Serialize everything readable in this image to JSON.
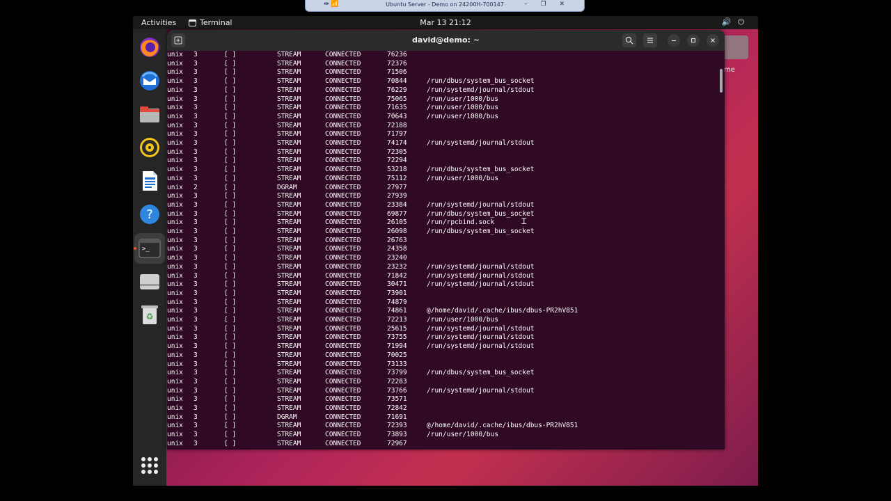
{
  "remote_bar": {
    "title": "Ubuntu Server - Demo on 24200H-700147",
    "left_icons": "⇹ 📶",
    "right_icons": "– ❐ ✕"
  },
  "topbar": {
    "activities": "Activities",
    "app_name": "Terminal",
    "clock": "Mar 13  21:12"
  },
  "desktop": {
    "home_label": "me"
  },
  "dock": {
    "items": [
      "Firefox",
      "Thunderbird",
      "Files",
      "Rhythmbox",
      "LibreOffice Writer",
      "Help",
      "Terminal",
      "Removable Drive",
      "Trash"
    ],
    "apps_button": "Show Applications"
  },
  "terminal": {
    "title": "david@demo: ~",
    "rows": [
      {
        "proto": "unix",
        "ref": "3",
        "flags": "[ ]",
        "type": "STREAM",
        "state": "CONNECTED",
        "inode": "76236",
        "path": ""
      },
      {
        "proto": "unix",
        "ref": "3",
        "flags": "[ ]",
        "type": "STREAM",
        "state": "CONNECTED",
        "inode": "72376",
        "path": ""
      },
      {
        "proto": "unix",
        "ref": "3",
        "flags": "[ ]",
        "type": "STREAM",
        "state": "CONNECTED",
        "inode": "71506",
        "path": ""
      },
      {
        "proto": "unix",
        "ref": "3",
        "flags": "[ ]",
        "type": "STREAM",
        "state": "CONNECTED",
        "inode": "70844",
        "path": "/run/dbus/system_bus_socket"
      },
      {
        "proto": "unix",
        "ref": "3",
        "flags": "[ ]",
        "type": "STREAM",
        "state": "CONNECTED",
        "inode": "76229",
        "path": "/run/systemd/journal/stdout"
      },
      {
        "proto": "unix",
        "ref": "3",
        "flags": "[ ]",
        "type": "STREAM",
        "state": "CONNECTED",
        "inode": "75065",
        "path": "/run/user/1000/bus"
      },
      {
        "proto": "unix",
        "ref": "3",
        "flags": "[ ]",
        "type": "STREAM",
        "state": "CONNECTED",
        "inode": "71635",
        "path": "/run/user/1000/bus"
      },
      {
        "proto": "unix",
        "ref": "3",
        "flags": "[ ]",
        "type": "STREAM",
        "state": "CONNECTED",
        "inode": "70643",
        "path": "/run/user/1000/bus"
      },
      {
        "proto": "unix",
        "ref": "3",
        "flags": "[ ]",
        "type": "STREAM",
        "state": "CONNECTED",
        "inode": "72188",
        "path": ""
      },
      {
        "proto": "unix",
        "ref": "3",
        "flags": "[ ]",
        "type": "STREAM",
        "state": "CONNECTED",
        "inode": "71797",
        "path": ""
      },
      {
        "proto": "unix",
        "ref": "3",
        "flags": "[ ]",
        "type": "STREAM",
        "state": "CONNECTED",
        "inode": "74174",
        "path": "/run/systemd/journal/stdout"
      },
      {
        "proto": "unix",
        "ref": "3",
        "flags": "[ ]",
        "type": "STREAM",
        "state": "CONNECTED",
        "inode": "72305",
        "path": ""
      },
      {
        "proto": "unix",
        "ref": "3",
        "flags": "[ ]",
        "type": "STREAM",
        "state": "CONNECTED",
        "inode": "72294",
        "path": ""
      },
      {
        "proto": "unix",
        "ref": "3",
        "flags": "[ ]",
        "type": "STREAM",
        "state": "CONNECTED",
        "inode": "53218",
        "path": "/run/dbus/system_bus_socket"
      },
      {
        "proto": "unix",
        "ref": "3",
        "flags": "[ ]",
        "type": "STREAM",
        "state": "CONNECTED",
        "inode": "75112",
        "path": "/run/user/1000/bus"
      },
      {
        "proto": "unix",
        "ref": "2",
        "flags": "[ ]",
        "type": "DGRAM",
        "state": "CONNECTED",
        "inode": "27977",
        "path": ""
      },
      {
        "proto": "unix",
        "ref": "3",
        "flags": "[ ]",
        "type": "STREAM",
        "state": "CONNECTED",
        "inode": "27939",
        "path": ""
      },
      {
        "proto": "unix",
        "ref": "3",
        "flags": "[ ]",
        "type": "STREAM",
        "state": "CONNECTED",
        "inode": "23384",
        "path": "/run/systemd/journal/stdout"
      },
      {
        "proto": "unix",
        "ref": "3",
        "flags": "[ ]",
        "type": "STREAM",
        "state": "CONNECTED",
        "inode": "69877",
        "path": "/run/dbus/system_bus_socket"
      },
      {
        "proto": "unix",
        "ref": "3",
        "flags": "[ ]",
        "type": "STREAM",
        "state": "CONNECTED",
        "inode": "26105",
        "path": "/run/rpcbind.sock"
      },
      {
        "proto": "unix",
        "ref": "3",
        "flags": "[ ]",
        "type": "STREAM",
        "state": "CONNECTED",
        "inode": "26098",
        "path": "/run/dbus/system_bus_socket"
      },
      {
        "proto": "unix",
        "ref": "3",
        "flags": "[ ]",
        "type": "STREAM",
        "state": "CONNECTED",
        "inode": "26763",
        "path": ""
      },
      {
        "proto": "unix",
        "ref": "3",
        "flags": "[ ]",
        "type": "STREAM",
        "state": "CONNECTED",
        "inode": "24358",
        "path": ""
      },
      {
        "proto": "unix",
        "ref": "3",
        "flags": "[ ]",
        "type": "STREAM",
        "state": "CONNECTED",
        "inode": "23240",
        "path": ""
      },
      {
        "proto": "unix",
        "ref": "3",
        "flags": "[ ]",
        "type": "STREAM",
        "state": "CONNECTED",
        "inode": "23232",
        "path": "/run/systemd/journal/stdout"
      },
      {
        "proto": "unix",
        "ref": "3",
        "flags": "[ ]",
        "type": "STREAM",
        "state": "CONNECTED",
        "inode": "71842",
        "path": "/run/systemd/journal/stdout"
      },
      {
        "proto": "unix",
        "ref": "3",
        "flags": "[ ]",
        "type": "STREAM",
        "state": "CONNECTED",
        "inode": "30471",
        "path": "/run/systemd/journal/stdout"
      },
      {
        "proto": "unix",
        "ref": "3",
        "flags": "[ ]",
        "type": "STREAM",
        "state": "CONNECTED",
        "inode": "73901",
        "path": ""
      },
      {
        "proto": "unix",
        "ref": "3",
        "flags": "[ ]",
        "type": "STREAM",
        "state": "CONNECTED",
        "inode": "74879",
        "path": ""
      },
      {
        "proto": "unix",
        "ref": "3",
        "flags": "[ ]",
        "type": "STREAM",
        "state": "CONNECTED",
        "inode": "74861",
        "path": "@/home/david/.cache/ibus/dbus-PR2hV851"
      },
      {
        "proto": "unix",
        "ref": "3",
        "flags": "[ ]",
        "type": "STREAM",
        "state": "CONNECTED",
        "inode": "72213",
        "path": "/run/user/1000/bus"
      },
      {
        "proto": "unix",
        "ref": "3",
        "flags": "[ ]",
        "type": "STREAM",
        "state": "CONNECTED",
        "inode": "25615",
        "path": "/run/systemd/journal/stdout"
      },
      {
        "proto": "unix",
        "ref": "3",
        "flags": "[ ]",
        "type": "STREAM",
        "state": "CONNECTED",
        "inode": "73755",
        "path": "/run/systemd/journal/stdout"
      },
      {
        "proto": "unix",
        "ref": "3",
        "flags": "[ ]",
        "type": "STREAM",
        "state": "CONNECTED",
        "inode": "71994",
        "path": "/run/systemd/journal/stdout"
      },
      {
        "proto": "unix",
        "ref": "3",
        "flags": "[ ]",
        "type": "STREAM",
        "state": "CONNECTED",
        "inode": "70025",
        "path": ""
      },
      {
        "proto": "unix",
        "ref": "3",
        "flags": "[ ]",
        "type": "STREAM",
        "state": "CONNECTED",
        "inode": "73133",
        "path": ""
      },
      {
        "proto": "unix",
        "ref": "3",
        "flags": "[ ]",
        "type": "STREAM",
        "state": "CONNECTED",
        "inode": "73799",
        "path": "/run/dbus/system_bus_socket"
      },
      {
        "proto": "unix",
        "ref": "3",
        "flags": "[ ]",
        "type": "STREAM",
        "state": "CONNECTED",
        "inode": "72283",
        "path": ""
      },
      {
        "proto": "unix",
        "ref": "3",
        "flags": "[ ]",
        "type": "STREAM",
        "state": "CONNECTED",
        "inode": "73766",
        "path": "/run/systemd/journal/stdout"
      },
      {
        "proto": "unix",
        "ref": "3",
        "flags": "[ ]",
        "type": "STREAM",
        "state": "CONNECTED",
        "inode": "73571",
        "path": ""
      },
      {
        "proto": "unix",
        "ref": "3",
        "flags": "[ ]",
        "type": "STREAM",
        "state": "CONNECTED",
        "inode": "72842",
        "path": ""
      },
      {
        "proto": "unix",
        "ref": "3",
        "flags": "[ ]",
        "type": "DGRAM",
        "state": "CONNECTED",
        "inode": "71691",
        "path": ""
      },
      {
        "proto": "unix",
        "ref": "3",
        "flags": "[ ]",
        "type": "STREAM",
        "state": "CONNECTED",
        "inode": "72393",
        "path": "@/home/david/.cache/ibus/dbus-PR2hV851"
      },
      {
        "proto": "unix",
        "ref": "3",
        "flags": "[ ]",
        "type": "STREAM",
        "state": "CONNECTED",
        "inode": "73893",
        "path": "/run/user/1000/bus"
      },
      {
        "proto": "unix",
        "ref": "3",
        "flags": "[ ]",
        "type": "STREAM",
        "state": "CONNECTED",
        "inode": "72967",
        "path": ""
      }
    ]
  },
  "colors": {
    "terminal_bg": "#300a24",
    "header_bg": "#2b2b2b",
    "accent": "#e95420"
  }
}
